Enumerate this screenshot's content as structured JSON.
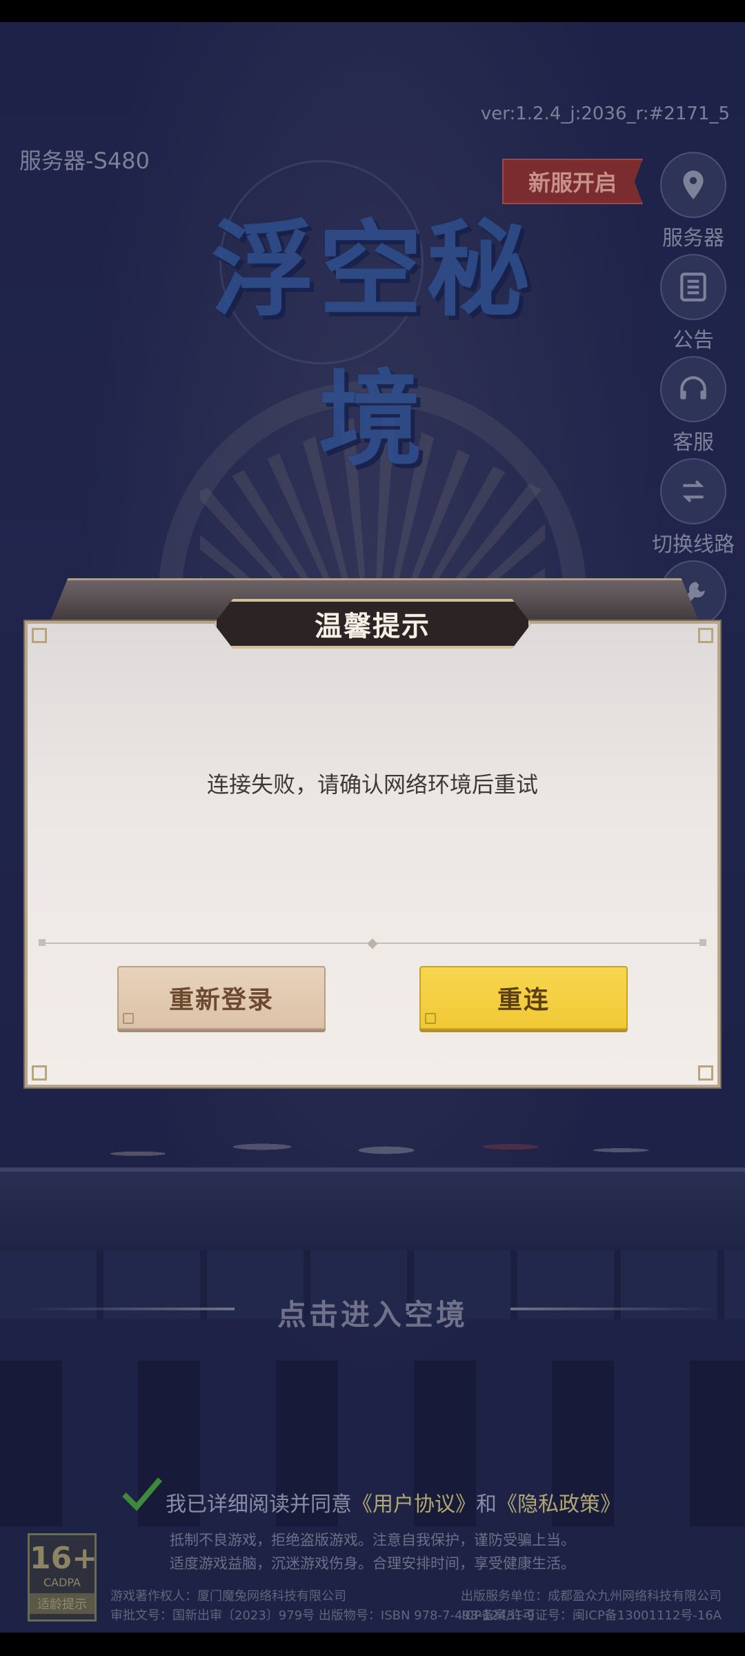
{
  "version": "ver:1.2.4_j:2036_r:#2171_5",
  "server_label": "服务器-S480",
  "new_server_badge": "新服开启",
  "game_title": "浮空秘境",
  "side_menu": [
    {
      "label": "服务器",
      "icon": "location-pin-icon"
    },
    {
      "label": "公告",
      "icon": "list-icon"
    },
    {
      "label": "客服",
      "icon": "headset-icon"
    },
    {
      "label": "切换线路",
      "icon": "switch-route-icon"
    },
    {
      "label": "",
      "icon": "wrench-icon"
    }
  ],
  "enter_prompt": "点击进入空境",
  "agreement": {
    "prefix": "我已详细阅读并同意",
    "user_agreement": "《用户协议》",
    "conjunction": "和",
    "privacy_policy": "《隐私政策》"
  },
  "health_notice": [
    "抵制不良游戏，拒绝盗版游戏。注意自我保护，谨防受骗上当。",
    "适度游戏益脑，沉迷游戏伤身。合理安排时间，享受健康生活。"
  ],
  "age_rating": {
    "number": "16+",
    "cadpa": "CADPA",
    "tip": "适龄提示"
  },
  "copyright": {
    "left_line1": "游戏著作权人：厦门魔兔网络科技有限公司",
    "left_line2": "审批文号：国新出审〔2023〕979号  出版物号：ISBN 978-7-498-12431-9",
    "right_line1": "出版服务单位：成都盈众九州网络科技有限公司",
    "right_line2": "ICP备案/许可证号：闽ICP备13001112号-16A"
  },
  "dialog": {
    "title": "温馨提示",
    "message": "连接失败，请确认网络环境后重试",
    "relogin_label": "重新登录",
    "reconnect_label": "重连"
  }
}
